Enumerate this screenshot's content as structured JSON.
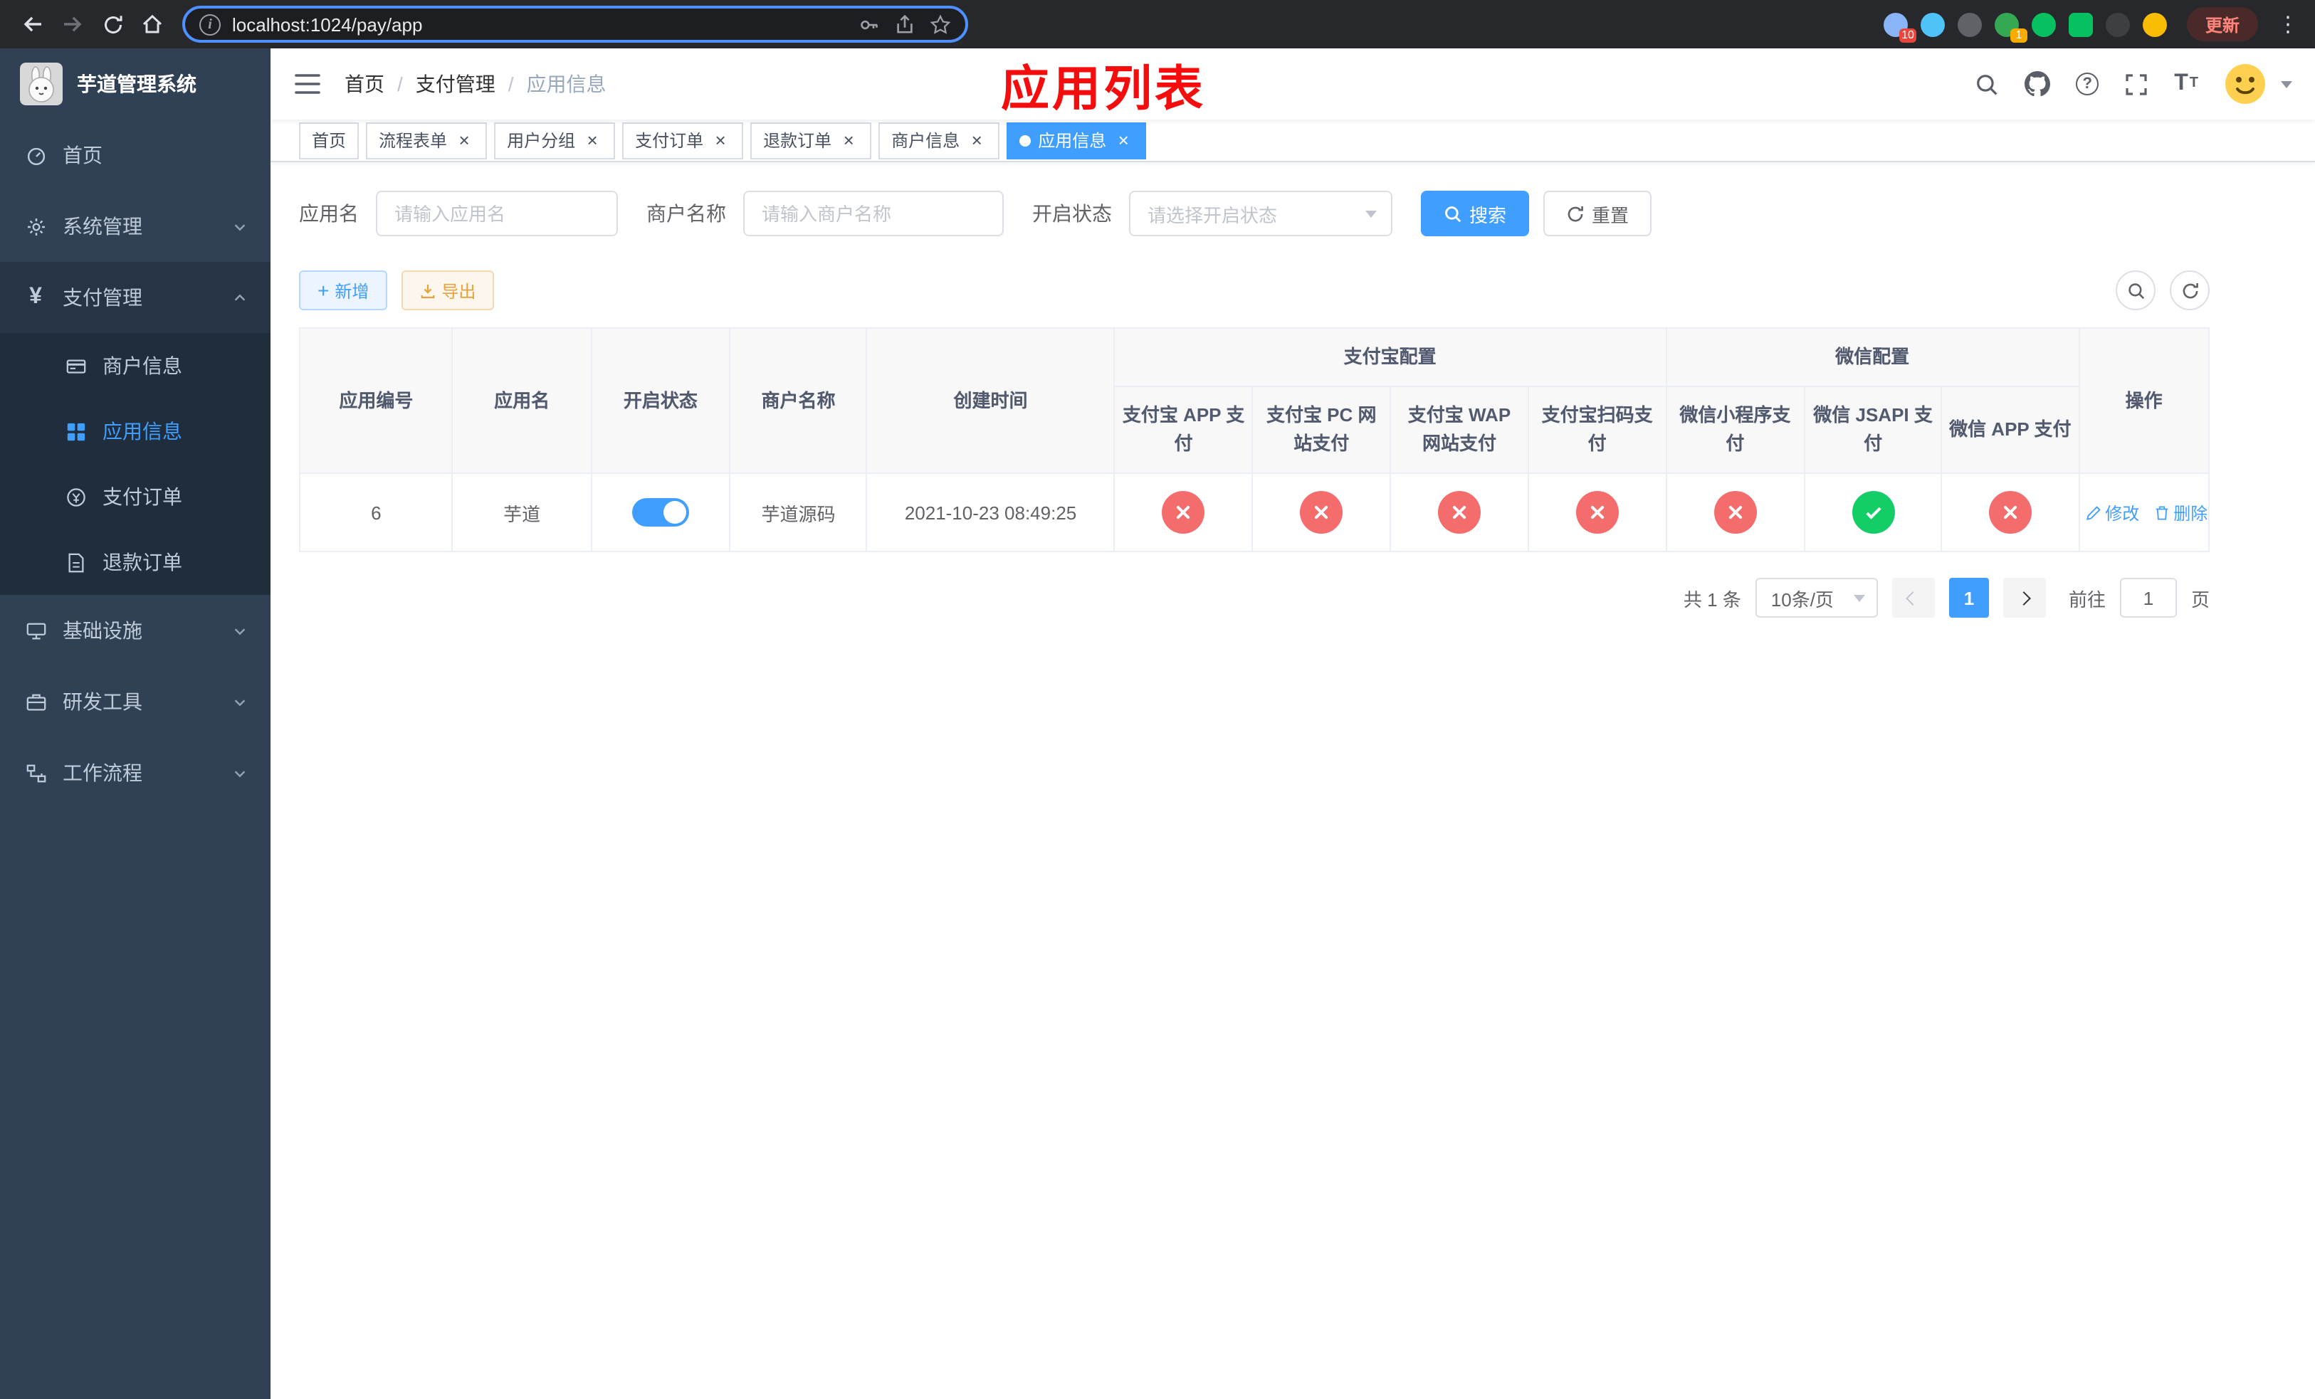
{
  "colors": {
    "primary": "#409EFF",
    "success": "#13CE66",
    "danger": "#F56C6C",
    "warning": "#E6A23C",
    "annotation": "#F50D0D"
  },
  "browser": {
    "url": "localhost:1024/pay/app",
    "update_button": "更新",
    "extensions": [
      {
        "key": "extension-1",
        "color": "#8ab4f8",
        "shape": "circle",
        "badge": "10",
        "badge_color": "#e8453c"
      },
      {
        "key": "extension-2",
        "color": "#4fc3f7",
        "shape": "circle"
      },
      {
        "key": "extension-3",
        "color": "#5f6368",
        "shape": "circle"
      },
      {
        "key": "extension-4",
        "color": "#34a853",
        "shape": "circle",
        "badge": "1",
        "badge_color": "#f9ab00"
      },
      {
        "key": "extension-5",
        "color": "#07c160",
        "shape": "circle"
      },
      {
        "key": "extension-6",
        "color": "#07c160",
        "shape": "square"
      },
      {
        "key": "extension-7",
        "color": "#3c4043",
        "shape": "circle"
      },
      {
        "key": "extension-8",
        "color": "#fbbc04",
        "shape": "circle"
      }
    ]
  },
  "sidebar": {
    "logo_title": "芋道管理系统",
    "items": [
      {
        "key": "home",
        "label": "首页",
        "icon": "dashboard-icon",
        "expandable": false
      },
      {
        "key": "system",
        "label": "系统管理",
        "icon": "gear-icon",
        "expandable": true
      },
      {
        "key": "pay",
        "label": "支付管理",
        "icon": "yen-icon",
        "expandable": true,
        "open": true,
        "children": [
          {
            "key": "merchant-info",
            "label": "商户信息",
            "icon": "merchant-icon"
          },
          {
            "key": "app-info",
            "label": "应用信息",
            "icon": "app-grid-icon",
            "active": true
          },
          {
            "key": "pay-order",
            "label": "支付订单",
            "icon": "pay-order-icon"
          },
          {
            "key": "refund-order",
            "label": "退款订单",
            "icon": "refund-icon"
          }
        ]
      },
      {
        "key": "infra",
        "label": "基础设施",
        "icon": "infra-icon",
        "expandable": true
      },
      {
        "key": "devtools",
        "label": "研发工具",
        "icon": "devtools-icon",
        "expandable": true
      },
      {
        "key": "workflow",
        "label": "工作流程",
        "icon": "workflow-icon",
        "expandable": true
      }
    ]
  },
  "navbar": {
    "breadcrumb": [
      "首页",
      "支付管理",
      "应用信息"
    ],
    "page_title": "应用列表"
  },
  "tabs": [
    {
      "key": "home",
      "label": "首页",
      "closable": false
    },
    {
      "key": "flow-form",
      "label": "流程表单",
      "closable": true
    },
    {
      "key": "user-group",
      "label": "用户分组",
      "closable": true
    },
    {
      "key": "pay-order",
      "label": "支付订单",
      "closable": true
    },
    {
      "key": "refund-order",
      "label": "退款订单",
      "closable": true
    },
    {
      "key": "merchant-info",
      "label": "商户信息",
      "closable": true
    },
    {
      "key": "app-info",
      "label": "应用信息",
      "closable": true,
      "active": true
    }
  ],
  "filters": {
    "app_name_label": "应用名",
    "app_name_placeholder": "请输入应用名",
    "merchant_label": "商户名称",
    "merchant_placeholder": "请输入商户名称",
    "status_label": "开启状态",
    "status_placeholder": "请选择开启状态",
    "search_button": "搜索",
    "reset_button": "重置"
  },
  "toolbar": {
    "add_button": "新增",
    "export_button": "导出"
  },
  "table": {
    "group_headers": {
      "alipay": "支付宝配置",
      "wechat": "微信配置"
    },
    "columns": [
      "应用编号",
      "应用名",
      "开启状态",
      "商户名称",
      "创建时间",
      "支付宝 APP 支付",
      "支付宝 PC 网站支付",
      "支付宝 WAP 网站支付",
      "支付宝扫码支付",
      "微信小程序支付",
      "微信 JSAPI 支付",
      "微信 APP 支付",
      "操作"
    ],
    "rows": [
      {
        "id": "6",
        "name": "芋道",
        "enabled": true,
        "merchant": "芋道源码",
        "created_at": "2021-10-23 08:49:25",
        "channels": [
          false,
          false,
          false,
          false,
          false,
          true,
          false
        ],
        "edit_label": "修改",
        "delete_label": "删除"
      }
    ]
  },
  "pagination": {
    "total_text": "共 1 条",
    "page_size": "10条/页",
    "current_page": "1",
    "goto_label": "前往",
    "goto_value": "1",
    "page_unit": "页"
  }
}
